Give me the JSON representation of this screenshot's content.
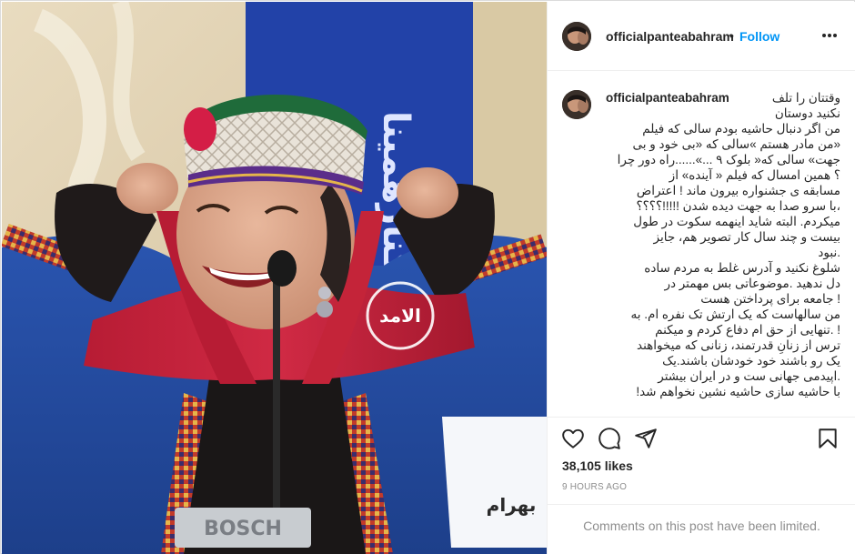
{
  "post": {
    "username": "officialpanteabahram",
    "follow_label": "Follow",
    "separator": "•",
    "more_icon": "more-options-icon"
  },
  "photo": {
    "description_icon": "post-photo",
    "watermark_text": "الامد",
    "mic_brand": "BOSCH",
    "banner_text": "ماکنارهمینا",
    "nameplate_text": "بهرام"
  },
  "caption": {
    "username": "officialpanteabahram",
    "lines": [
      "وقتتان را تلف",
      "نکنید دوستان",
      "من اگر دنبال حاشیه بودم سالی که فیلم",
      "«من مادر هستم »سالی که «بی خود و بی",
      "جهت» سالی که« بلوک ۹ ...»......راه دور چرا",
      "؟ همین امسال که فیلم « آینده» از",
      "مسابقه ی جشنواره بیرون ماند ! اعتراض",
      "،با سرو صدا به جهت دیده شدن !!!!!؟؟؟؟",
      "میکردم. البته شاید اینهمه سکوت در طول",
      "بیست و چند سال کار تصویر هم، جایز",
      ".نبود",
      "شلوغ نکنید و آدرس غلط به مردم ساده",
      "دل ندهید .موضوعاتی بس مهمتر در",
      "! جامعه برای پرداختن هست",
      "من سالهاست که یک ارتش تک نفره ام. به",
      "! .تنهایی از حق ام دفاع کردم و میکنم",
      "ترس از زنانِ قدرتمند، زنانی که میخواهند",
      "یک رو باشند خود خودشان باشند.یک",
      ".اپیدمی جهانی ست و در ایران بیشتر",
      "با حاشیه سازی حاشیه نشین نخواهم شد!"
    ]
  },
  "actions": {
    "like_icon": "heart-icon",
    "comment_icon": "comment-icon",
    "share_icon": "share-icon",
    "save_icon": "bookmark-icon"
  },
  "stats": {
    "likes": "38,105 likes",
    "time": "9 HOURS AGO"
  },
  "footer": {
    "limited_text": "Comments on this post have been limited."
  },
  "colors": {
    "follow_blue": "#0095f6",
    "text": "#262626",
    "muted": "#8e8e8e",
    "border": "#efefef"
  }
}
